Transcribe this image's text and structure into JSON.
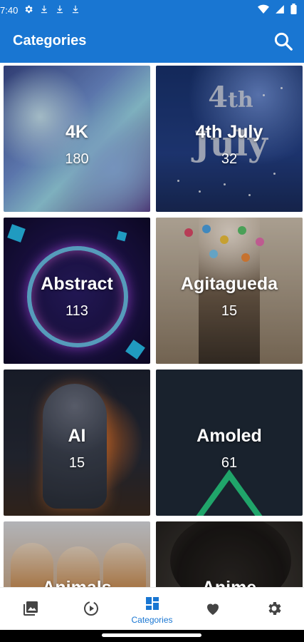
{
  "status_bar": {
    "time": "7:40",
    "left_icons": [
      "gear-icon",
      "download-icon",
      "download-icon",
      "download-icon"
    ],
    "right_icons": [
      "wifi-icon",
      "signal-icon",
      "battery-icon"
    ]
  },
  "app_bar": {
    "title": "Categories",
    "search_icon": "search-icon"
  },
  "categories": [
    {
      "name": "4K",
      "count": "180"
    },
    {
      "name": "4th July",
      "count": "32"
    },
    {
      "name": "Abstract",
      "count": "113"
    },
    {
      "name": "Agitagueda",
      "count": "15"
    },
    {
      "name": "AI",
      "count": "15"
    },
    {
      "name": "Amoled",
      "count": "61"
    },
    {
      "name": "Animals",
      "count": ""
    },
    {
      "name": "Anime",
      "count": ""
    }
  ],
  "bottom_nav": {
    "items": [
      {
        "icon": "image-icon",
        "label": ""
      },
      {
        "icon": "video-icon",
        "label": ""
      },
      {
        "icon": "categories-icon",
        "label": "Categories",
        "active": true
      },
      {
        "icon": "heart-icon",
        "label": ""
      },
      {
        "icon": "settings-icon",
        "label": ""
      }
    ]
  },
  "colors": {
    "primary": "#1976d2",
    "nav_inactive": "#444444"
  }
}
